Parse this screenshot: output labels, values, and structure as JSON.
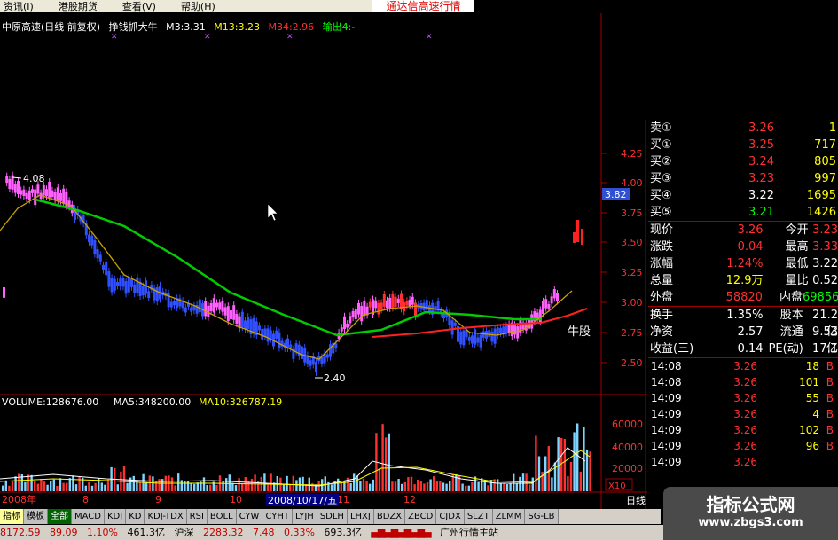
{
  "menu": [
    "资讯(I)",
    "港股期货",
    "查看(V)",
    "帮助(H)"
  ],
  "app_title": "通达信高速行情",
  "stock_header": {
    "name": "中原高速(日线 前复权)",
    "indicator": "挣钱抓大牛",
    "m3": "M3:3.31",
    "m13": "M13:3.23",
    "m34": "M34:2.96",
    "output": "输出4:-"
  },
  "price_axis": [
    "4.25",
    "4.00",
    "3.75",
    "3.50",
    "3.25",
    "3.00",
    "2.75",
    "2.50"
  ],
  "current_price_tag": "3.82",
  "annotations": {
    "high": "4.08",
    "low": "2.40",
    "bull": "牛股"
  },
  "volume_header": {
    "volume": "VOLUME:128676.00",
    "ma5": "MA5:348200.00",
    "ma10": "MA10:326787.19"
  },
  "volume_axis": [
    "60000",
    "40000",
    "20000"
  ],
  "volume_unit": "X10",
  "time_axis": {
    "start": "2008年",
    "months": [
      "8",
      "9",
      "10",
      "11",
      "12"
    ],
    "cursor_date": "2008/10/17/五"
  },
  "period_label": "日线",
  "order_book": [
    {
      "label": "卖①",
      "price": "3.26",
      "vol": "1"
    },
    {
      "label": "买①",
      "price": "3.25",
      "vol": "717"
    },
    {
      "label": "买②",
      "price": "3.24",
      "vol": "805"
    },
    {
      "label": "买③",
      "price": "3.23",
      "vol": "997"
    },
    {
      "label": "买④",
      "price": "3.22",
      "vol": "1695"
    },
    {
      "label": "买⑤",
      "price": "3.21",
      "vol": "1426"
    }
  ],
  "stats": [
    {
      "l1": "现价",
      "v1": "3.26",
      "l2": "今开",
      "v2": "3.23"
    },
    {
      "l1": "涨跌",
      "v1": "0.04",
      "l2": "最高",
      "v2": "3.33"
    },
    {
      "l1": "涨幅",
      "v1": "1.24%",
      "l2": "最低",
      "v2": "3.22"
    },
    {
      "l1": "总量",
      "v1": "12.9万",
      "l2": "量比",
      "v2": "0.52"
    },
    {
      "l1": "外盘",
      "v1": "58820",
      "l2": "内盘",
      "v2": "69856"
    },
    {
      "l1": "换手",
      "v1": "1.35%",
      "l2": "股本",
      "v2": "21.2亿"
    },
    {
      "l1": "净资",
      "v1": "2.57",
      "l2": "流通",
      "v2": "9.53亿"
    },
    {
      "l1": "收益(三)",
      "v1": "0.14",
      "l2": "PE(动)",
      "v2": "17.1"
    }
  ],
  "ticks": [
    {
      "time": "14:08",
      "price": "3.26",
      "vol": "18",
      "side": "B"
    },
    {
      "time": "14:08",
      "price": "3.26",
      "vol": "101",
      "side": "B"
    },
    {
      "time": "14:09",
      "price": "3.26",
      "vol": "55",
      "side": "B"
    },
    {
      "time": "14:09",
      "price": "3.26",
      "vol": "4",
      "side": "B"
    },
    {
      "time": "14:09",
      "price": "3.26",
      "vol": "102",
      "side": "B"
    },
    {
      "time": "14:09",
      "price": "3.26",
      "vol": "96",
      "side": "B"
    },
    {
      "time": "14:09",
      "price": "3.26",
      "vol": "",
      "side": ""
    }
  ],
  "tabs": [
    "指标",
    "模板",
    "全部",
    "MACD",
    "KDJ",
    "KD",
    "KDJ-TDX",
    "RSI",
    "BOLL",
    "CYW",
    "CYHT",
    "LYJH",
    "SDLH",
    "LHXJ",
    "BDZX",
    "ZBCD",
    "CJDX",
    "SLZT",
    "ZLMM",
    "SG-LB"
  ],
  "status": [
    "8172.59",
    "89.09",
    "1.10%",
    "461.3亿",
    "沪深",
    "2283.32",
    "7.48",
    "0.33%",
    "693.3亿",
    "广州行情主站"
  ],
  "watermark": {
    "title": "指标公式网",
    "url": "www.zbgs3.com"
  },
  "colors": {
    "up": "#ff3030",
    "down": "#3050ff",
    "ma_green": "#00cc00",
    "ma_yellow": "#ccaa00",
    "ma_red": "#ff2020"
  }
}
